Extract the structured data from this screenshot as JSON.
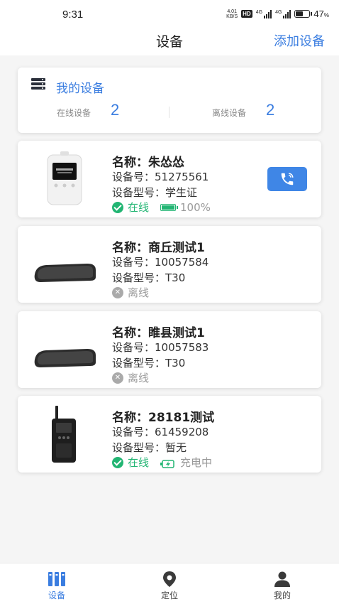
{
  "status_bar": {
    "time": "9:31",
    "net_speed_top": "4.01",
    "net_speed_bottom": "KB/S",
    "hd": "HD",
    "sig1": "4G",
    "sig2": "4G",
    "battery_percent": "47",
    "battery_unit": "%"
  },
  "nav": {
    "title": "设备",
    "add_button": "添加设备"
  },
  "summary": {
    "title": "我的设备",
    "online_label": "在线设备",
    "online_count": "2",
    "offline_label": "离线设备",
    "offline_count": "2"
  },
  "devices": [
    {
      "name": "名称：朱怂怂",
      "number": "设备号：51275561",
      "model": "设备型号：学生证",
      "status": "在线",
      "battery": "100%",
      "icon": "student-card-device"
    },
    {
      "name": "名称：商丘测试1",
      "number": "设备号：10057584",
      "model": "设备型号：T30",
      "status": "离线",
      "icon": "rearview-mirror-device"
    },
    {
      "name": "名称：睢县测试1",
      "number": "设备号：10057583",
      "model": "设备型号：T30",
      "status": "离线",
      "icon": "rearview-mirror-device"
    },
    {
      "name": "名称：28181测试",
      "number": "设备号：61459208",
      "model": "设备型号：暂无",
      "status": "在线",
      "charging": "充电中",
      "icon": "walkie-talkie-device"
    }
  ],
  "tabs": [
    {
      "label": "设备",
      "icon": "devices-icon",
      "active": true
    },
    {
      "label": "定位",
      "icon": "location-pin-icon",
      "active": false
    },
    {
      "label": "我的",
      "icon": "user-icon",
      "active": false
    }
  ],
  "colors": {
    "accent": "#3a7de0",
    "online": "#22b573",
    "offline": "#999999",
    "background": "#f5f5f5"
  }
}
